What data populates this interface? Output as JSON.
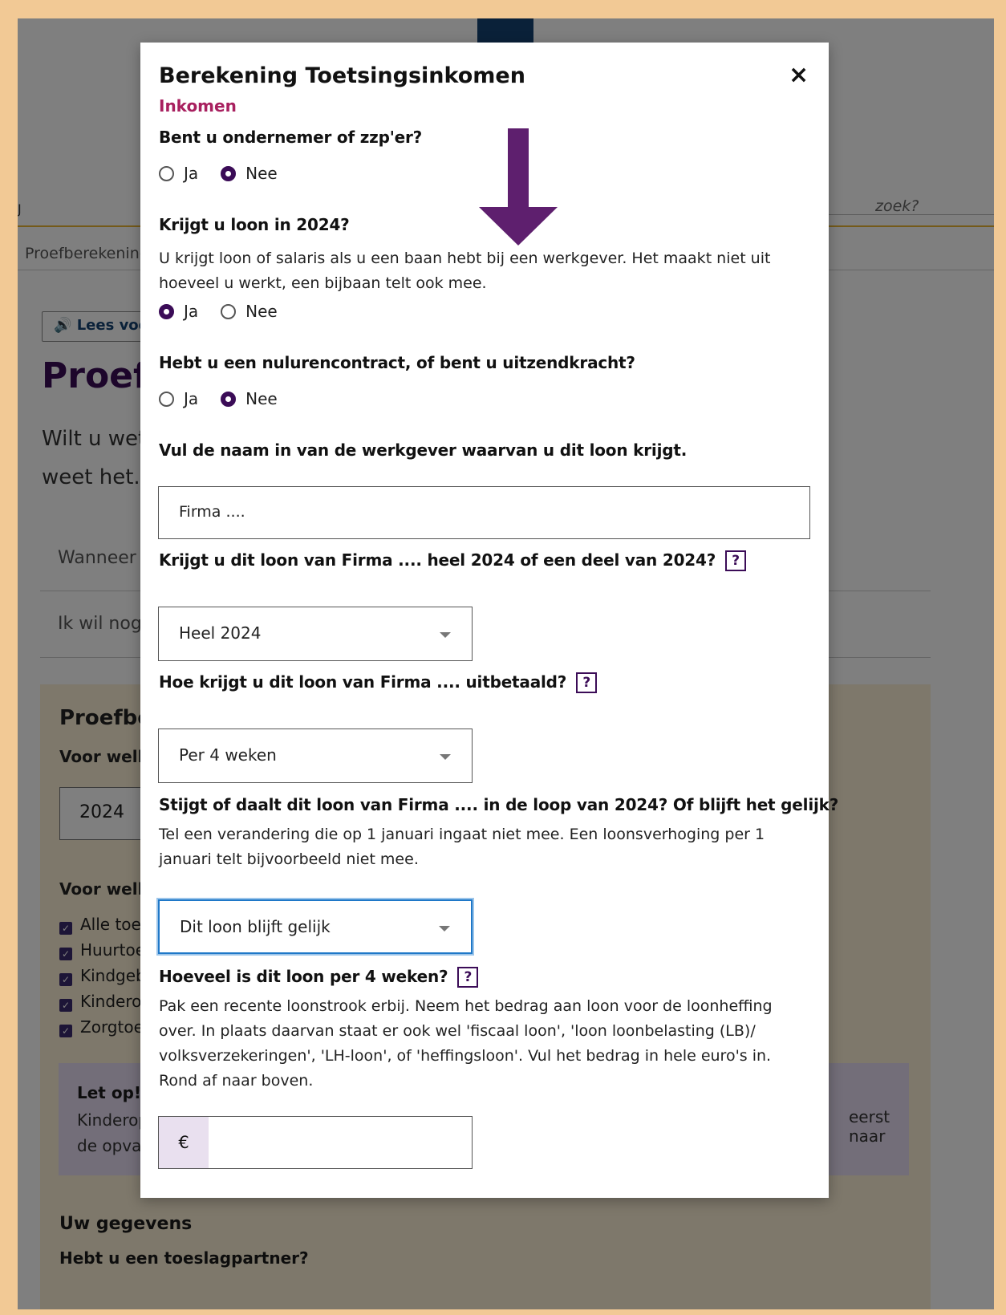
{
  "background": {
    "left_marker": "J",
    "search_placeholder": "zoek?",
    "breadcrumb": "Proefberekening",
    "read_aloud": "Lees voor",
    "page_title": "Proefberekening",
    "intro_line1": "Wilt u weten",
    "intro_line2": "weet het.",
    "accordion_1": "Wanneer",
    "accordion_2": "Ik wil nog",
    "panel_title": "Proefberekening",
    "panel_question_year": "Voor welk",
    "year_value": "2024",
    "panel_question_allowances": "Voor welke",
    "allowances": [
      "Alle toeslagen",
      "Huurtoeslag",
      "Kindgebonden budget",
      "Kinderopvangtoeslag",
      "Zorgtoeslag"
    ],
    "warning_title": "Let op!",
    "warning_line1": "Kinderopvangtoeslag",
    "warning_line2": "de opvang",
    "warning_right": "eerst naar",
    "section_title": "Uw gegevens",
    "partner_question": "Hebt u een toeslagpartner?"
  },
  "modal": {
    "title": "Berekening Toetsingsinkomen",
    "close_symbol": "×",
    "subtitle": "Inkomen",
    "q1": {
      "label": "Bent u ondernemer of zzp'er?",
      "options": [
        "Ja",
        "Nee"
      ],
      "selected": "Nee"
    },
    "q2": {
      "label": "Krijgt u loon in 2024?",
      "help": "U krijgt loon of salaris als u een baan hebt bij een werkgever. Het maakt niet uit hoeveel u werkt, een bijbaan telt ook mee.",
      "options": [
        "Ja",
        "Nee"
      ],
      "selected": "Ja"
    },
    "q3": {
      "label": "Hebt u een nulurencontract, of bent u uitzendkracht?",
      "options": [
        "Ja",
        "Nee"
      ],
      "selected": "Nee"
    },
    "q4": {
      "label": "Vul de naam in van de werkgever waarvan u dit loon krijgt.",
      "value": "Firma ...."
    },
    "q5": {
      "label": "Krijgt u dit loon van Firma .... heel 2024 of een deel van 2024?",
      "help_symbol": "?",
      "value": "Heel 2024"
    },
    "q6": {
      "label": "Hoe krijgt u dit loon van Firma .... uitbetaald?",
      "help_symbol": "?",
      "value": "Per 4 weken"
    },
    "q7": {
      "label": "Stijgt of daalt dit loon van Firma .... in de loop van 2024? Of blijft het gelijk?",
      "help": "Tel een verandering die op 1 januari ingaat niet mee. Een loonsverhoging per 1 januari telt bijvoorbeeld niet mee.",
      "value": "Dit loon blijft gelijk"
    },
    "q8": {
      "label": "Hoeveel is dit loon per 4 weken?",
      "help_symbol": "?",
      "help": "Pak een recente loonstrook erbij. Neem het bedrag aan loon voor de loonheffing over. In plaats daarvan staat er ook wel 'fiscaal loon', 'loon loonbelasting (LB)/ volksverzekeringen', 'LH-loon', of 'heffingsloon'. Vul het bedrag in hele euro's in. Rond af naar boven.",
      "currency": "€",
      "value": ""
    }
  },
  "colors": {
    "frame": "#f2c995",
    "accent_purple": "#3b0c57",
    "subtitle_pink": "#a8205f",
    "focus_blue": "#1f78c8",
    "arrow": "#5e1f6e"
  },
  "icons": [
    "close-icon",
    "speaker-icon",
    "help-icon",
    "chevron-down-icon",
    "arrow-down-icon",
    "checkbox-checked-icon"
  ]
}
